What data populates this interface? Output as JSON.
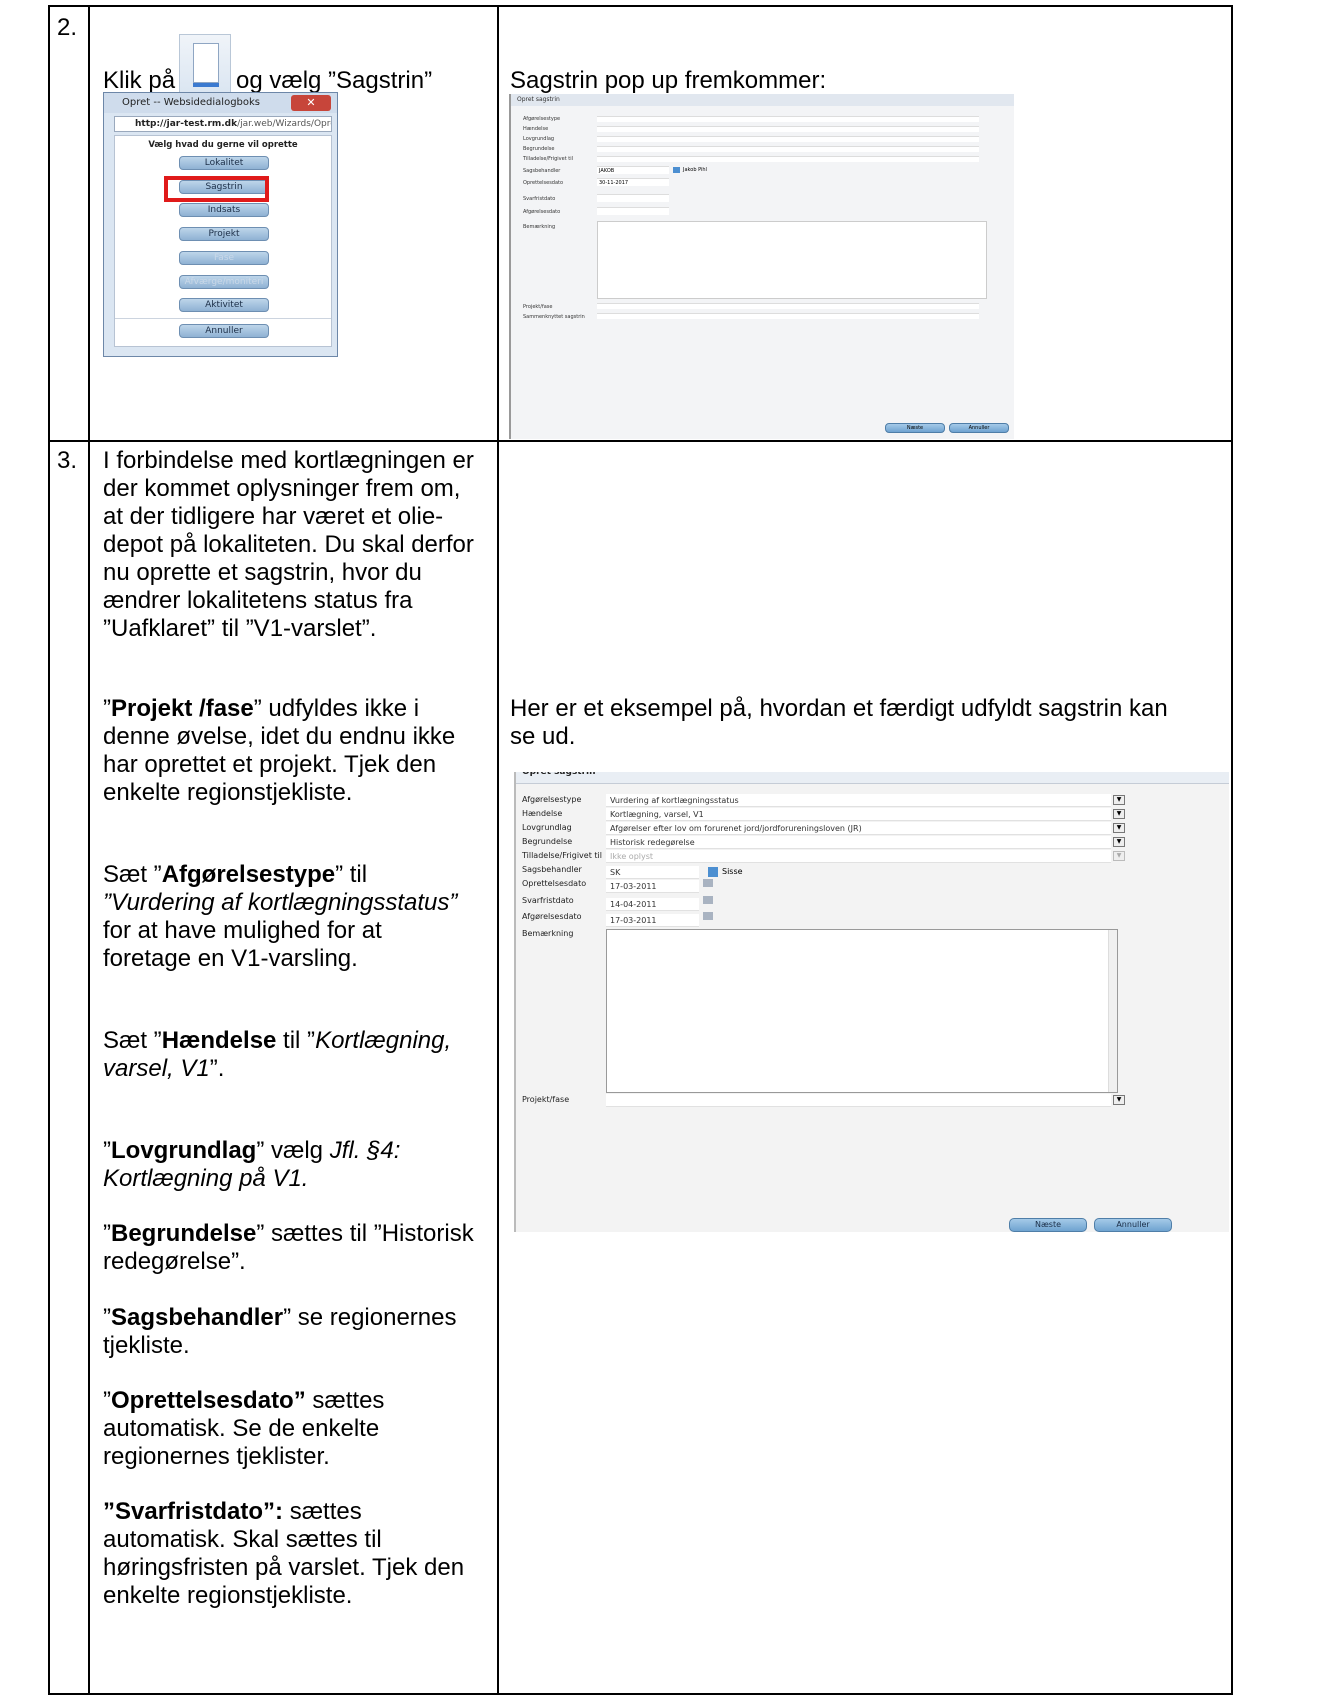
{
  "rows": [
    {
      "number": "2.",
      "left_text_before": "Klik på",
      "left_text_after": "og vælg ”Sagstrin”",
      "right_caption": "Sagstrin pop up fremkommer:"
    },
    {
      "number": "3.",
      "intro": [
        "I forbindelse med kortlægningen er",
        "der kommet oplysninger frem om,",
        "at der tidligere har været et olie-",
        "depot på lokaliteten. Du skal derfor",
        "nu oprette et sagstrin, hvor du",
        "ændrer lokalitetens status fra",
        "”Uafklaret” til ”V1-varslet”."
      ],
      "right_caption_line1": "Her er et eksempel på, hvordan et færdigt udfyldt sagstrin kan",
      "right_caption_line2": "se ud."
    }
  ],
  "instructions": {
    "projekt_q1": "”",
    "projekt_bold": "Projekt /fase",
    "projekt_rest": "” udfyldes ikke i",
    "projekt_l2": "denne øvelse, idet du endnu ikke",
    "projekt_l3": "har oprettet et projekt. Tjek den",
    "projekt_l4": "enkelte regionstjekliste.",
    "afg_q1": "Sæt ”",
    "afg_bold": "Afgørelsestype",
    "afg_rest": "” til",
    "afg_l2": "”Vurdering af kortlægningsstatus”",
    "afg_l3": "for at have mulighed for at",
    "afg_l4": "foretage en V1-varsling.",
    "haend_q1": "Sæt ”",
    "haend_bold": "Hændelse",
    "haend_rest": " til ”",
    "haend_ital": "Kortlægning,",
    "haend_l2_ital": "varsel, V1",
    "haend_l2_rest": "”.",
    "lov_q1": "”",
    "lov_bold": "Lovgrundlag",
    "lov_rest": "” vælg ",
    "lov_ital": "Jfl. §4:",
    "lov_l2_ital": "Kortlægning på V1.",
    "beg_q1": "”",
    "beg_bold": "Begrundelse",
    "beg_rest": "” sættes til ”Historisk",
    "beg_l2": "redegørelse”.",
    "sags_q1": "”",
    "sags_bold": "Sagsbehandler",
    "sags_rest": "” se regionernes",
    "sags_l2": "tjekliste.",
    "opr_q1": "”",
    "opr_bold": "Oprettelsesdato”",
    "opr_rest": " sættes",
    "opr_l2": "automatisk. Se de enkelte",
    "opr_l3": "regionernes tjeklister.",
    "svar_bold": "”Svarfristdato”:",
    "svar_rest": " sættes",
    "svar_l2": "automatisk. Skal sættes til",
    "svar_l3": "høringsfristen på varslet. Tjek den",
    "svar_l4": "enkelte regionstjekliste."
  },
  "dialog": {
    "title": "Opret -- Websidedialogboks",
    "url_host": "http://jar-test.rm.dk",
    "url_path": "/jar.web/Wizards/OpretValg.as",
    "heading": "Vælg hvad du gerne vil oprette",
    "buttons": [
      "Lokalitet",
      "Sagstrin",
      "Indsats",
      "Projekt",
      "Fase",
      "Afværge/moniteri",
      "Aktivitet",
      "Annuller"
    ]
  },
  "popup_small": {
    "title": "Opret sagstrin",
    "labels": [
      "Afgørelsestype",
      "Hændelse",
      "Lovgrundlag",
      "Begrundelse",
      "Tilladelse/Frigivet til",
      "Sagsbehandler",
      "Oprettelsesdato",
      "Svarfristdato",
      "Afgørelsesdato",
      "Bemærkning",
      "Projekt/fase",
      "Sammenknyttet sagstrin"
    ],
    "sagsbehandler_value": "JAKOB",
    "sagsbehandler_name": "Jakob Pihl",
    "oprettelsesdato_value": "30-11-2017",
    "next_label": "Næste",
    "cancel_label": "Annuller"
  },
  "popup_large": {
    "title": "Opret sagstrin",
    "labels": [
      "Afgørelsestype",
      "Hændelse",
      "Lovgrundlag",
      "Begrundelse",
      "Tilladelse/Frigivet til",
      "Sagsbehandler",
      "Oprettelsesdato",
      "Svarfristdato",
      "Afgørelsesdato",
      "Bemærkning",
      "Projekt/fase"
    ],
    "values": {
      "afgorelsestype": "Vurdering af kortlægningsstatus",
      "haendelse": "Kortlægning, varsel, V1",
      "lovgrundlag": "Afgørelser efter lov om forurenet jord/jordforureningsloven (JR)",
      "begrundelse": "Historisk redegørelse",
      "tilladelse": "Ikke oplyst",
      "sagsbehandler": "SK",
      "sagsbehandler_name": "Sisse",
      "oprettelsesdato": "17-03-2011",
      "svarfristdato": "14-04-2011",
      "afgorelsesdato": "17-03-2011"
    },
    "next_label": "Næste",
    "cancel_label": "Annuller"
  }
}
